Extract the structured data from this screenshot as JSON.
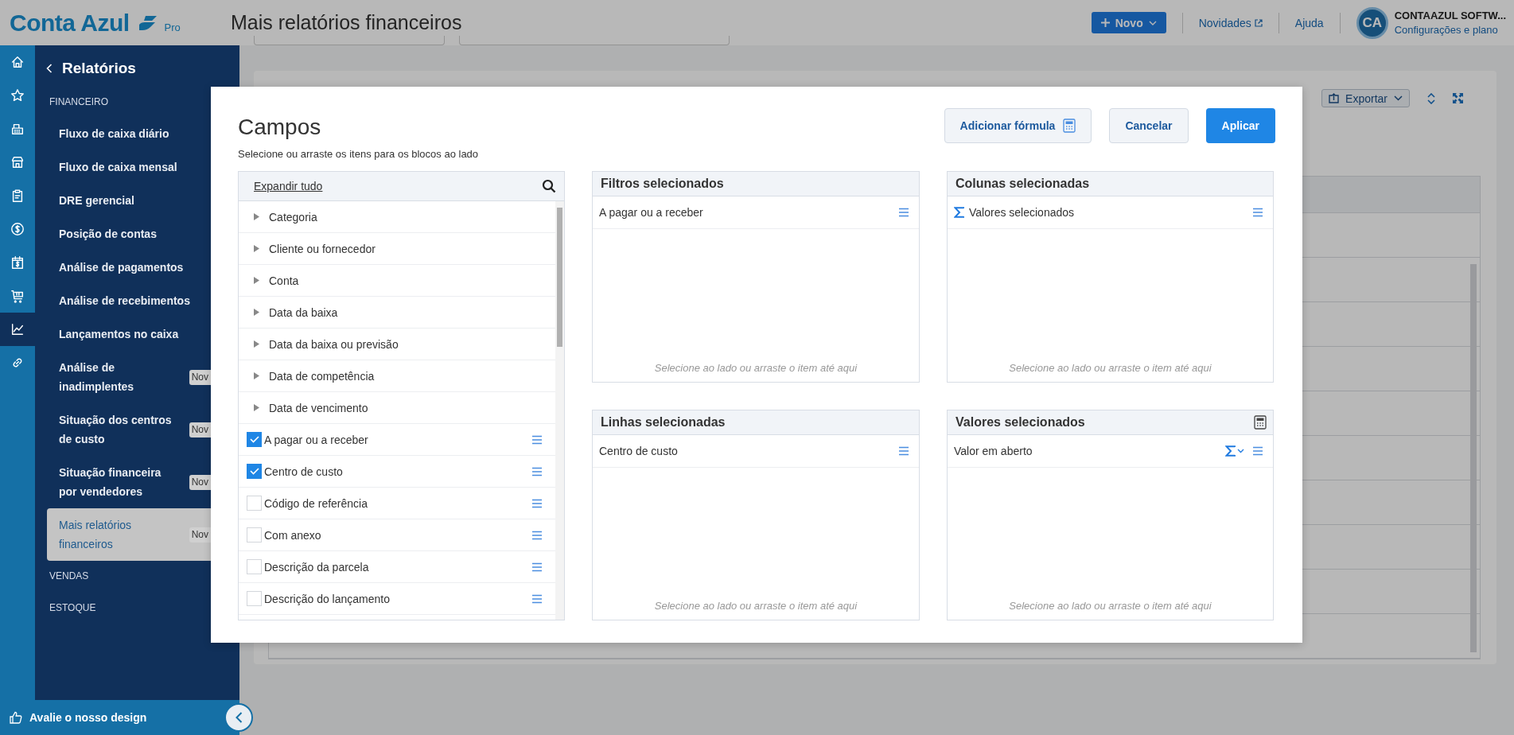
{
  "header": {
    "logo": "Conta Azul",
    "logo_badge": "Pro",
    "title": "Mais relatórios financeiros",
    "new_button": "Novo",
    "links": [
      {
        "label": "Novidades",
        "external": true
      },
      {
        "label": "Ajuda",
        "external": false
      }
    ],
    "avatar": "CA",
    "account_name": "CONTAAZUL SOFTW...",
    "account_link": "Configurações e plano"
  },
  "sidebar": {
    "rail": [
      {
        "kind": "home",
        "selected": false
      },
      {
        "kind": "star",
        "selected": false
      },
      {
        "kind": "register",
        "selected": false
      },
      {
        "kind": "store",
        "selected": false
      },
      {
        "kind": "clipboard",
        "selected": false
      },
      {
        "kind": "dollar",
        "selected": false
      },
      {
        "kind": "calendar",
        "selected": false
      },
      {
        "kind": "cart",
        "selected": false
      },
      {
        "kind": "chart",
        "selected": true
      },
      {
        "kind": "link",
        "selected": false
      }
    ],
    "back_label": "Relatórios",
    "sections": [
      {
        "label": "FINANCEIRO",
        "items": [
          {
            "label": "Fluxo de caixa diário",
            "selected": false
          },
          {
            "label": "Fluxo de caixa mensal",
            "selected": false
          },
          {
            "label": "DRE gerencial",
            "selected": false
          },
          {
            "label": "Posição de contas",
            "selected": false
          },
          {
            "label": "Análise de pagamentos",
            "selected": false
          },
          {
            "label": "Análise de recebimentos",
            "selected": false
          },
          {
            "label": "Lançamentos no caixa",
            "selected": false
          },
          {
            "label": "Análise de inadimplentes",
            "badge": "Nov",
            "selected": false
          },
          {
            "label": "Situação dos centros de custo",
            "badge": "Nov",
            "selected": false
          },
          {
            "label": "Situação financeira por vendedores",
            "badge": "Nov",
            "selected": false
          },
          {
            "label": "Mais relatórios financeiros",
            "badge": "Nov",
            "selected": true
          }
        ]
      },
      {
        "label": "VENDAS"
      },
      {
        "label": "ESTOQUE"
      }
    ],
    "footer": "Avalie o nosso design"
  },
  "report": {
    "export_button": "Exportar"
  },
  "modal": {
    "title": "Campos",
    "subtitle": "Selecione ou arraste os itens para os blocos ao lado",
    "buttons": [
      {
        "label": "Adicionar fórmula",
        "kind": "formula"
      },
      {
        "label": "Cancelar",
        "kind": "secondary"
      },
      {
        "label": "Aplicar",
        "kind": "primary"
      }
    ],
    "field_list": {
      "expand_all": "Expandir tudo",
      "items": [
        {
          "kind": "group",
          "label": "Categoria"
        },
        {
          "kind": "group",
          "label": "Cliente ou fornecedor"
        },
        {
          "kind": "group",
          "label": "Conta"
        },
        {
          "kind": "group",
          "label": "Data da baixa"
        },
        {
          "kind": "group",
          "label": "Data da baixa ou previsão"
        },
        {
          "kind": "group",
          "label": "Data de competência"
        },
        {
          "kind": "group",
          "label": "Data de vencimento"
        },
        {
          "kind": "field",
          "label": "A pagar ou a receber",
          "checked": true
        },
        {
          "kind": "field",
          "label": "Centro de custo",
          "checked": true
        },
        {
          "kind": "field",
          "label": "Código de referência",
          "checked": false
        },
        {
          "kind": "field",
          "label": "Com anexo",
          "checked": false
        },
        {
          "kind": "field",
          "label": "Descrição da parcela",
          "checked": false
        },
        {
          "kind": "field",
          "label": "Descrição do lançamento",
          "checked": false
        }
      ]
    },
    "panels": [
      {
        "kind": "filters",
        "title": "Filtros selecionados",
        "items": [
          {
            "kind": "plain",
            "label": "A pagar ou a receber"
          }
        ],
        "hint": "Selecione ao lado ou arraste o item até aqui"
      },
      {
        "kind": "columns",
        "title": "Colunas selecionadas",
        "items": [
          {
            "kind": "sum",
            "label": "Valores selecionados"
          }
        ],
        "hint": "Selecione ao lado ou arraste o item até aqui"
      },
      {
        "kind": "rows",
        "title": "Linhas selecionadas",
        "items": [
          {
            "kind": "plain",
            "label": "Centro de custo"
          }
        ],
        "hint": "Selecione ao lado ou arraste o item até aqui"
      },
      {
        "kind": "values",
        "title": "Valores selecionados",
        "items": [
          {
            "kind": "aggregate",
            "label": "Valor em aberto"
          }
        ],
        "hint": "Selecione ao lado ou arraste o item até aqui"
      }
    ]
  }
}
